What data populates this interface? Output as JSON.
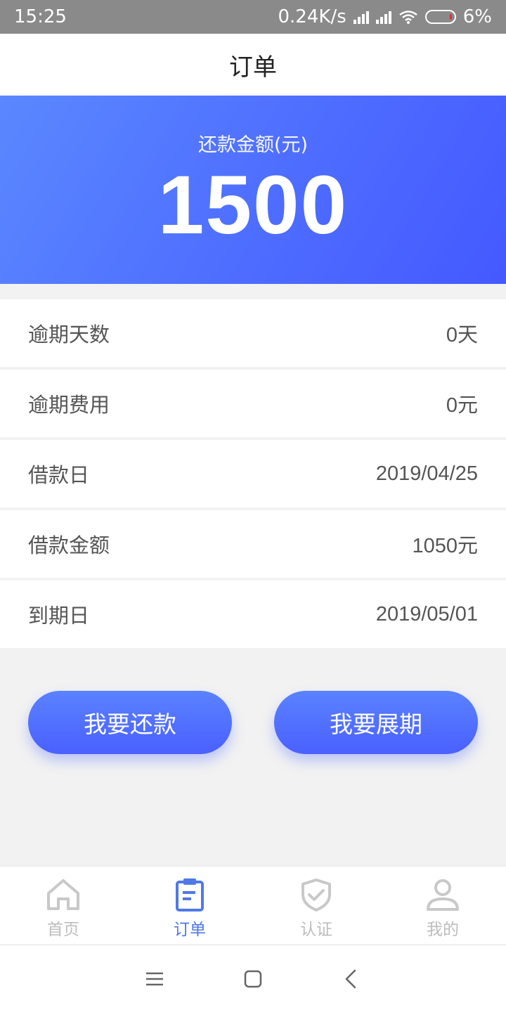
{
  "status": {
    "time": "15:25",
    "speed": "0.24K/s",
    "battery": "6%"
  },
  "header": {
    "title": "订单"
  },
  "hero": {
    "label": "还款金额(元)",
    "amount": "1500"
  },
  "details": [
    {
      "label": "逾期天数",
      "value": "0天"
    },
    {
      "label": "逾期费用",
      "value": "0元"
    },
    {
      "label": "借款日",
      "value": "2019/04/25"
    },
    {
      "label": "借款金额",
      "value": "1050元"
    },
    {
      "label": "到期日",
      "value": "2019/05/01"
    }
  ],
  "actions": {
    "repay": "我要还款",
    "extend": "我要展期"
  },
  "tabs": [
    {
      "label": "首页",
      "icon": "home-icon",
      "active": false
    },
    {
      "label": "订单",
      "icon": "clipboard-icon",
      "active": true
    },
    {
      "label": "认证",
      "icon": "shield-check-icon",
      "active": false
    },
    {
      "label": "我的",
      "icon": "user-icon",
      "active": false
    }
  ],
  "colors": {
    "accent": "#4f79e8",
    "hero_start": "#5a88ff",
    "hero_end": "#4459ff",
    "tab_inactive": "#bdbdbd"
  }
}
